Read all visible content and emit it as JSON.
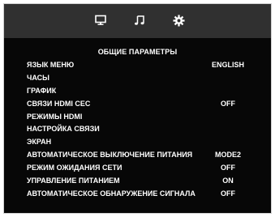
{
  "tabs": [
    {
      "icon": "monitor-icon",
      "selected": true
    },
    {
      "icon": "music-note-icon",
      "selected": false
    },
    {
      "icon": "gear-icon",
      "selected": false
    }
  ],
  "menu": {
    "title": "ОБЩИЕ ПАРАМЕТРЫ",
    "items": [
      {
        "label": "ЯЗЫК МЕНЮ",
        "value": "ENGLISH"
      },
      {
        "label": "ЧАСЫ",
        "value": ""
      },
      {
        "label": "ГРАФИК",
        "value": ""
      },
      {
        "label": "СВЯЗИ HDMI CEC",
        "value": "OFF"
      },
      {
        "label": "РЕЖИМЫ HDMI",
        "value": ""
      },
      {
        "label": "НАСТРОЙКА СВЯЗИ",
        "value": ""
      },
      {
        "label": "ЭКРАН",
        "value": ""
      },
      {
        "label": "АВТОМАТИЧЕСКОЕ ВЫКЛЮЧЕНИЕ ПИТАНИЯ",
        "value": "MODE2"
      },
      {
        "label": "РЕЖИМ ОЖИДАНИЯ СЕТИ",
        "value": "OFF"
      },
      {
        "label": "УПРАВЛЕНИЕ ПИТАНИЕМ",
        "value": "ON"
      },
      {
        "label": "АВТОМАТИЧЕСКОЕ ОБНАРУЖЕНИЕ СИГНАЛА",
        "value": "OFF"
      }
    ]
  },
  "colors": {
    "background": "#070707",
    "topbar": "#303030",
    "text": "#ffffff"
  }
}
